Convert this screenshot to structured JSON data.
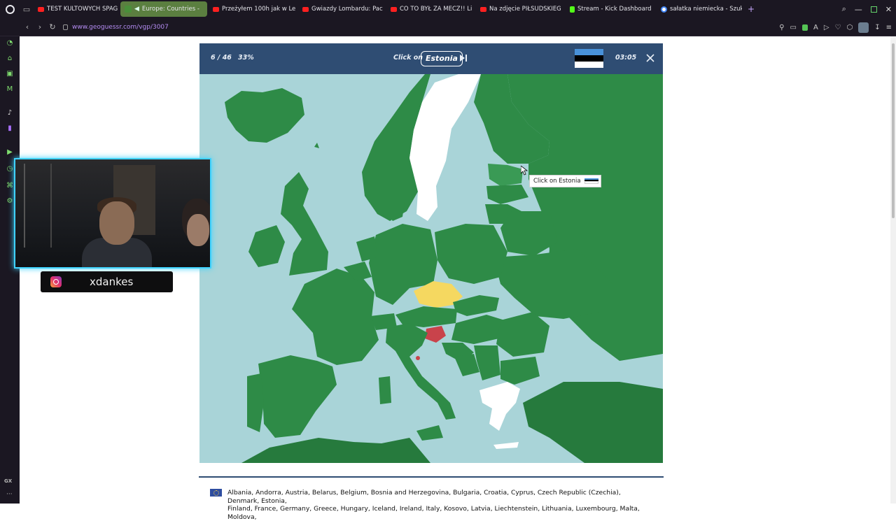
{
  "browser": {
    "tabs": [
      {
        "label": "TEST KULTOWYCH SPAG",
        "icon": "youtube-icon",
        "active": false
      },
      {
        "label": "Europe: Countries - ",
        "icon": "geoguessr-icon",
        "active": true
      },
      {
        "label": "Przeżyłem 100h jak w Le",
        "icon": "youtube-icon",
        "active": false
      },
      {
        "label": "Gwiazdy Lombardu: Pac",
        "icon": "youtube-icon",
        "active": false
      },
      {
        "label": "CO TO BYŁ ZA MECZ!! Li",
        "icon": "youtube-icon",
        "active": false
      },
      {
        "label": "Na zdjęcie PIŁSUDSKIEG",
        "icon": "youtube-icon",
        "active": false
      },
      {
        "label": "Stream - Kick Dashboard",
        "icon": "kick-icon",
        "active": false
      },
      {
        "label": "sałatka niemiecka - Szuka",
        "icon": "google-icon",
        "active": false
      }
    ],
    "url": "www.geoguessr.com/vgp/3007"
  },
  "game": {
    "progress": "6 / 46",
    "percent": "33%",
    "prompt_label": "Click on",
    "target_country": "Estonia",
    "timer": "03:05",
    "flag_colors": [
      "#4891d9",
      "#000000",
      "#ffffff"
    ]
  },
  "map": {
    "land_color": "#2e8b47",
    "land_dark_color": "#267a3d",
    "sea_color": "#a9d4d8",
    "found_color": "#ffffff",
    "highlight_yellow": "#f5d860",
    "wrong_red": "#c9434b"
  },
  "tooltip": {
    "text": "Click on Estonia"
  },
  "overlay": {
    "instagram_handle": "xdankes"
  },
  "country_list": {
    "line1": "Albania, Andorra, Austria, Belarus, Belgium, Bosnia and Herzegovina, Bulgaria, Croatia, Cyprus, Czech Republic (Czechia), Denmark, Estonia,",
    "line2": "Finland, France, Germany, Greece, Hungary, Iceland, Ireland, Italy, Kosovo, Latvia, Liechtenstein, Lithuania, Luxembourg, Malta, Moldova,"
  }
}
